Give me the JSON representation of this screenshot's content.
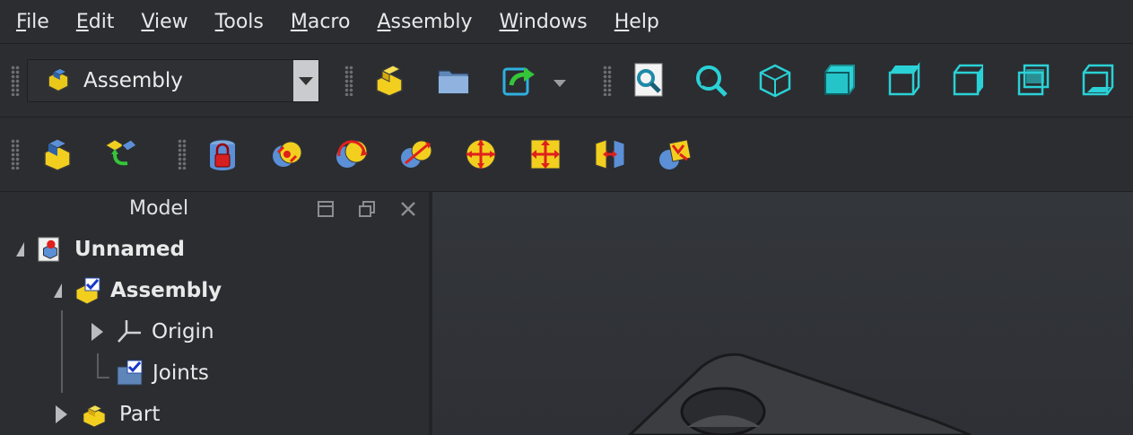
{
  "menubar": {
    "items": [
      {
        "label": "File",
        "underline": "F",
        "rest": "ile"
      },
      {
        "label": "Edit",
        "underline": "E",
        "rest": "dit"
      },
      {
        "label": "View",
        "underline": "V",
        "rest": "iew"
      },
      {
        "label": "Tools",
        "underline": "T",
        "rest": "ools"
      },
      {
        "label": "Macro",
        "underline": "M",
        "rest": "acro"
      },
      {
        "label": "Assembly",
        "underline": "A",
        "rest": "ssembly"
      },
      {
        "label": "Windows",
        "underline": "W",
        "rest": "indows"
      },
      {
        "label": "Help",
        "underline": "H",
        "rest": "elp"
      }
    ]
  },
  "workbench_selector": {
    "value": "Assembly"
  },
  "panel": {
    "title": "Model"
  },
  "tree": {
    "document": "Unnamed",
    "assembly": "Assembly",
    "origin": "Origin",
    "joints": "Joints",
    "part": "Part"
  },
  "colors": {
    "accent_cyan": "#2ad1d6",
    "yellow": "#f3d21c",
    "red": "#e0201c"
  }
}
